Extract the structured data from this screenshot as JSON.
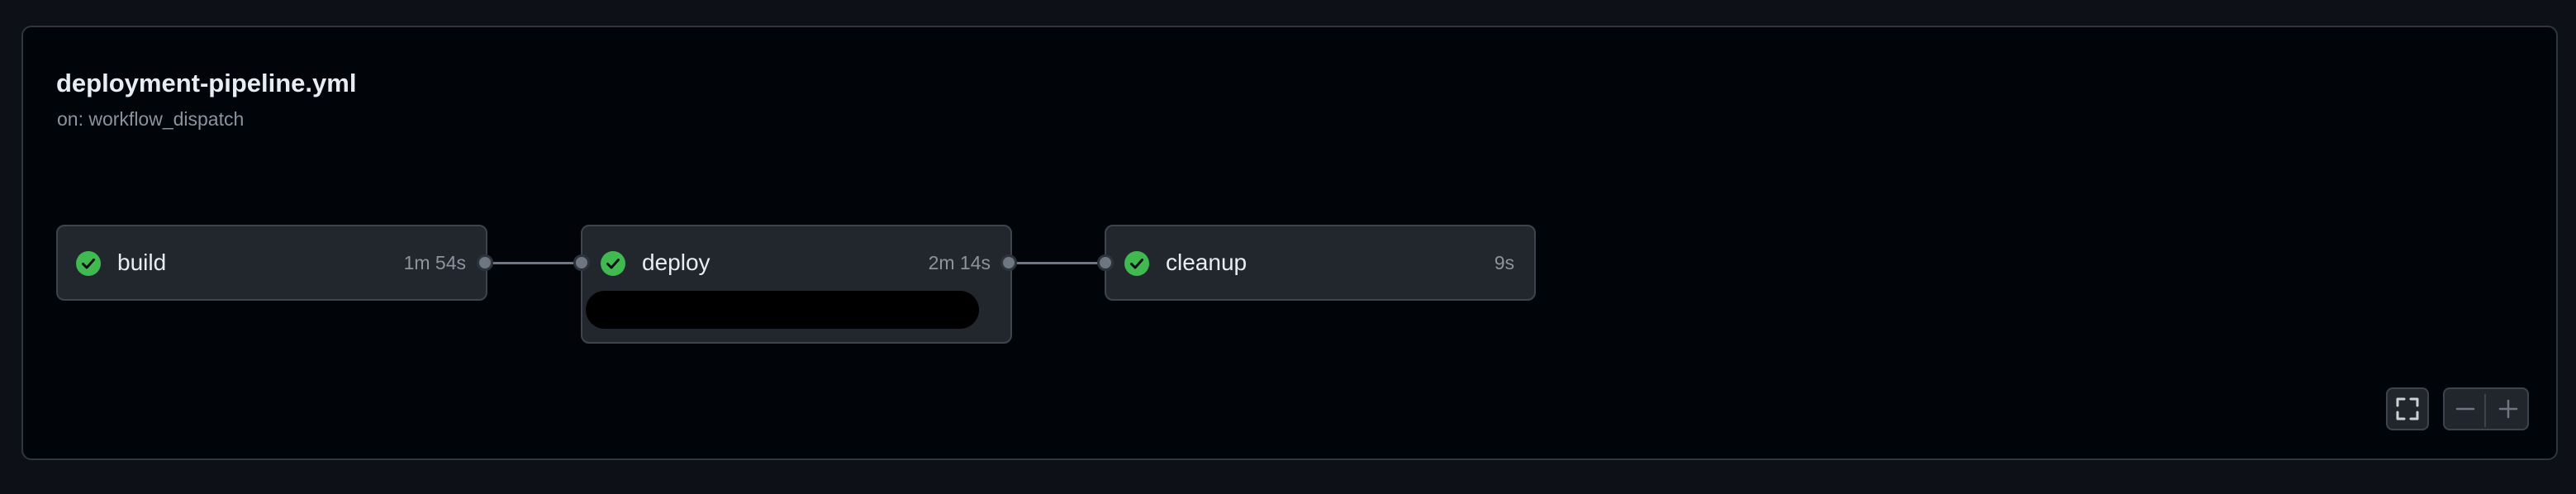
{
  "workflow": {
    "file_name": "deployment-pipeline.yml",
    "trigger": "on: workflow_dispatch"
  },
  "jobs": [
    {
      "name": "build",
      "duration": "1m 54s",
      "status": "success",
      "status_icon": "check-circle-icon"
    },
    {
      "name": "deploy",
      "duration": "2m 14s",
      "status": "success",
      "status_icon": "check-circle-icon"
    },
    {
      "name": "cleanup",
      "duration": "9s",
      "status": "success",
      "status_icon": "check-circle-icon"
    }
  ],
  "controls": {
    "fullscreen_icon": "fullscreen-icon",
    "zoom_out_icon": "minus-icon",
    "zoom_in_icon": "plus-icon"
  },
  "colors": {
    "success": "#3fb950",
    "background": "#010409",
    "node_background": "#22272e"
  }
}
